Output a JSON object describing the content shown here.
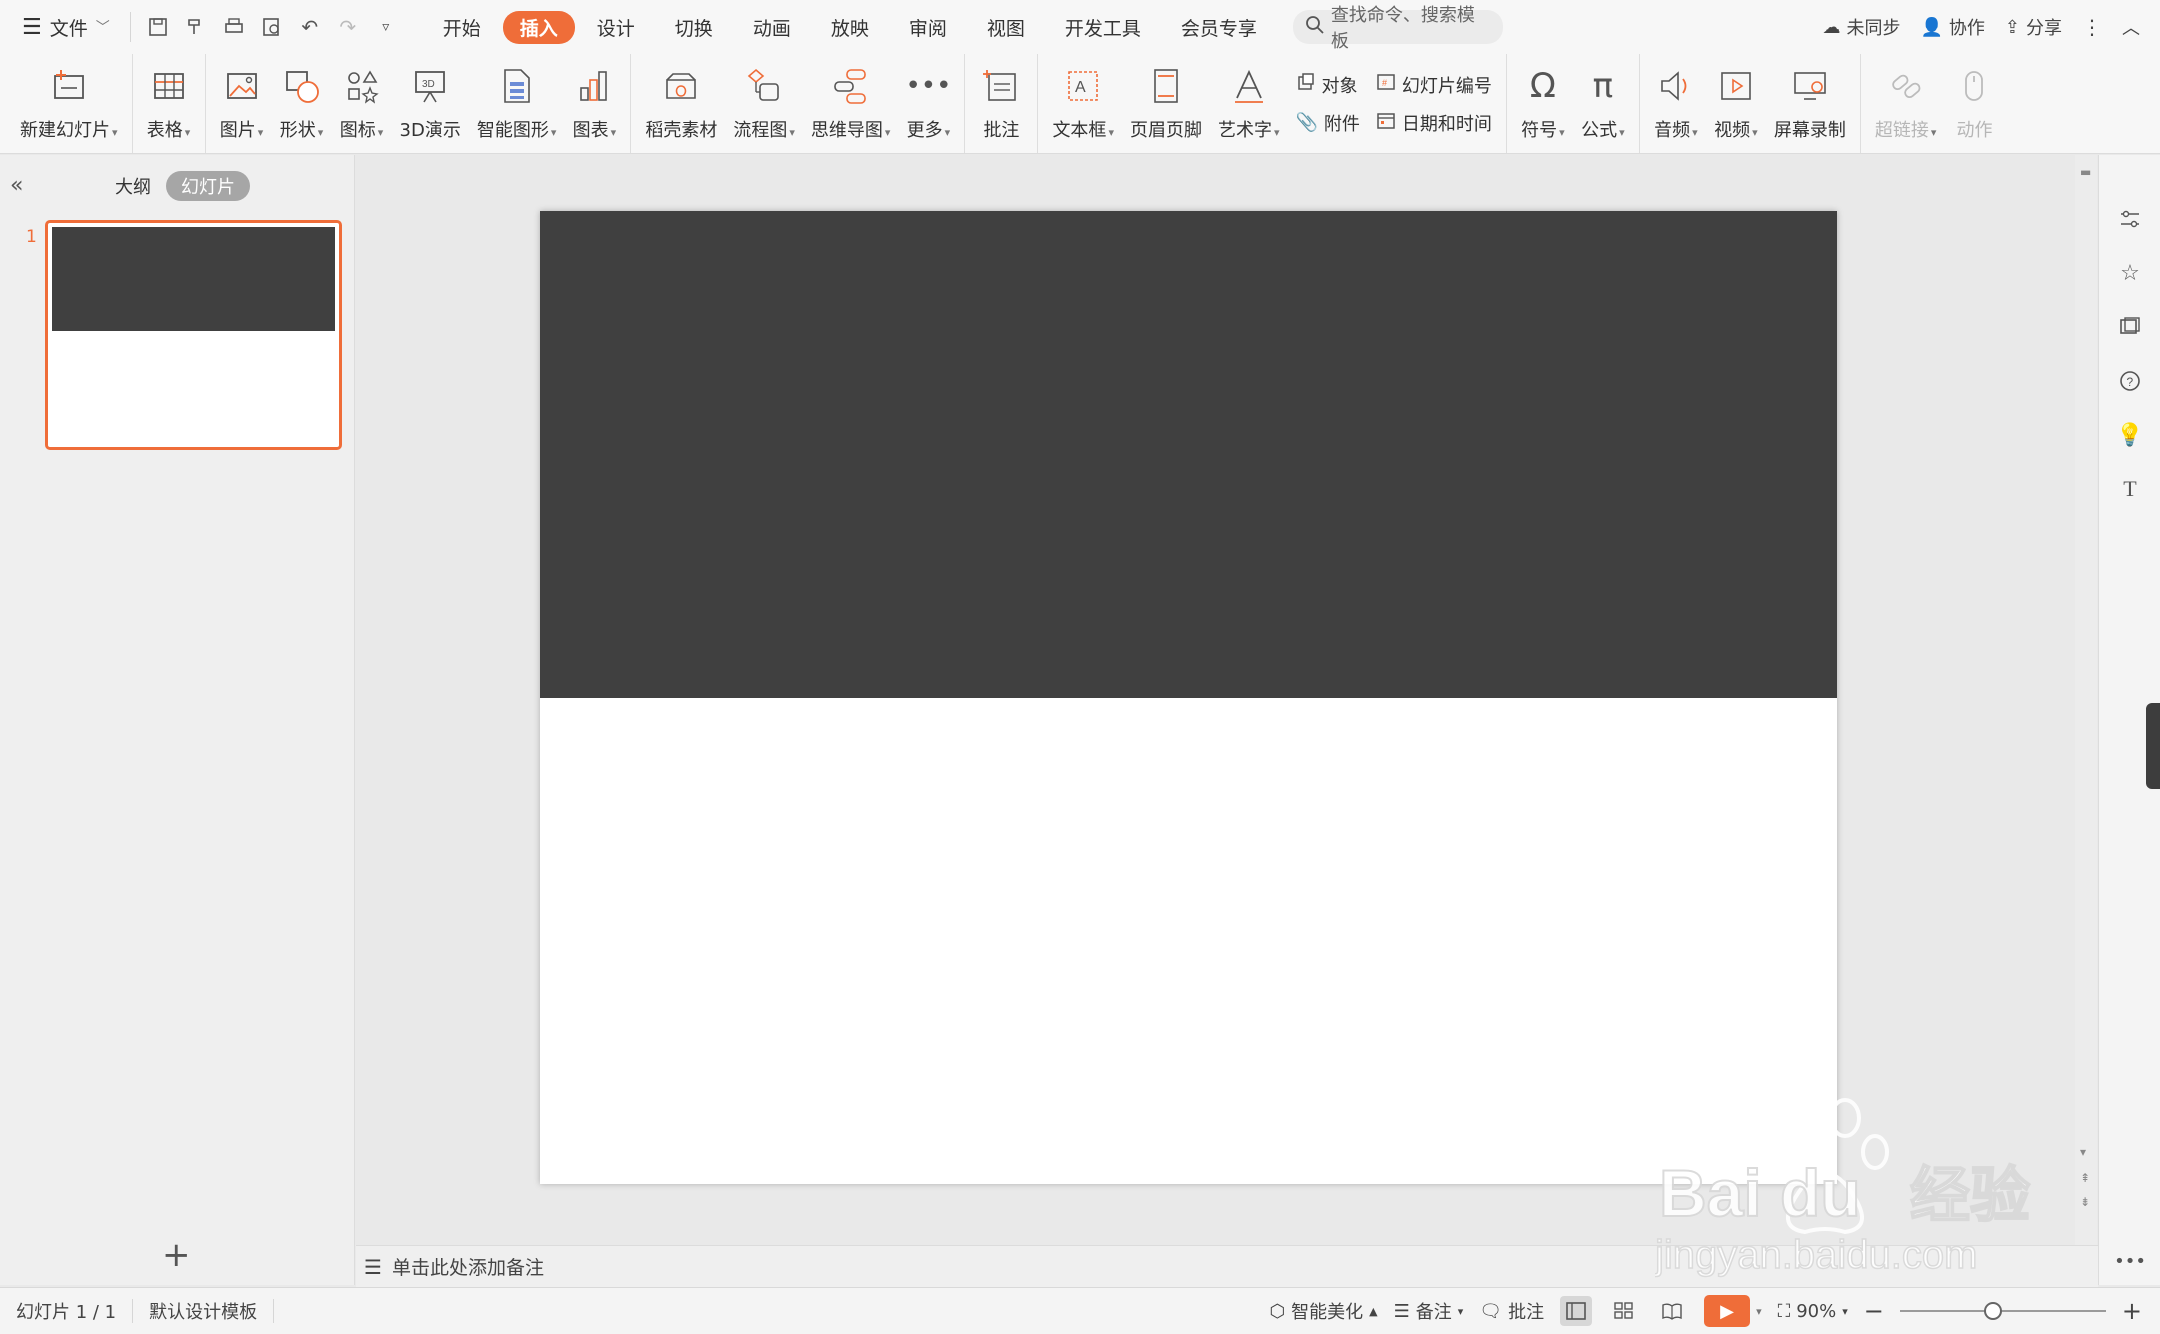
{
  "menubar": {
    "file_label": "文件",
    "tabs": [
      "开始",
      "插入",
      "设计",
      "切换",
      "动画",
      "放映",
      "审阅",
      "视图",
      "开发工具",
      "会员专享"
    ],
    "active_tab": "插入",
    "search_placeholder": "查找命令、搜索模板",
    "sync_label": "未同步",
    "collab_label": "协作",
    "share_label": "分享"
  },
  "ribbon": {
    "new_slide": "新建幻灯片",
    "table": "表格",
    "picture": "图片",
    "shape": "形状",
    "icon": "图标",
    "demo3d": "3D演示",
    "smartart": "智能图形",
    "chart": "图表",
    "material": "稻壳素材",
    "flowchart": "流程图",
    "mindmap": "思维导图",
    "more": "更多",
    "comment": "批注",
    "textbox": "文本框",
    "header_footer": "页眉页脚",
    "wordart": "艺术字",
    "object": "对象",
    "slide_number": "幻灯片编号",
    "attachment": "附件",
    "datetime": "日期和时间",
    "symbol": "符号",
    "formula": "公式",
    "audio": "音频",
    "video": "视频",
    "screen_record": "屏幕录制",
    "hyperlink": "超链接",
    "action": "动作"
  },
  "left_panel": {
    "outline_tab": "大纲",
    "slides_tab": "幻灯片",
    "slide_number": "1"
  },
  "notes": {
    "placeholder": "单击此处添加备注"
  },
  "status": {
    "slide_count": "幻灯片 1 / 1",
    "template": "默认设计模板",
    "beautify": "智能美化",
    "notes": "备注",
    "comment": "批注",
    "zoom": "90%"
  },
  "watermark": {
    "brand": "Baidu经验",
    "url": "jingyan.baidu.com"
  },
  "colors": {
    "accent": "#ef6d39",
    "slide_band": "#404040"
  }
}
